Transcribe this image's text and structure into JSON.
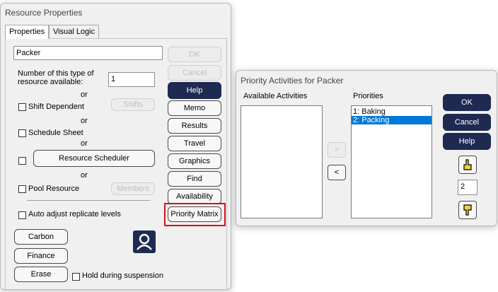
{
  "resource_dialog": {
    "title": "Resource Properties",
    "tabs": [
      "Properties",
      "Visual Logic"
    ],
    "name_value": "Packer",
    "count_label_line1": "Number of this type of",
    "count_label_line2": "resource available:",
    "count_value": "1",
    "or_text": "or",
    "shift_dependent_label": "Shift Dependent",
    "shifts_button": "Shifts",
    "schedule_sheet_label": "Schedule Sheet",
    "resource_scheduler_button": "Resource Scheduler",
    "pool_resource_label": "Pool Resource",
    "members_button": "Members",
    "auto_adjust_label": "Auto adjust replicate levels",
    "carbon_button": "Carbon",
    "finance_button": "Finance",
    "erase_button": "Erase",
    "hold_label": "Hold during suspension",
    "buttons": {
      "ok": "OK",
      "cancel": "Cancel",
      "help": "Help",
      "memo": "Memo",
      "results": "Results",
      "travel": "Travel",
      "graphics": "Graphics",
      "find": "Find",
      "availability": "Availability",
      "priority_matrix": "Priority Matrix"
    }
  },
  "priority_dialog": {
    "title": "Priority Activities for Packer",
    "available_label": "Available Activities",
    "priorities_label": "Priorities",
    "priorities": [
      "1: Baking",
      "2: Packing"
    ],
    "selected_index": 1,
    "add_button": ">",
    "remove_button": "<",
    "ok": "OK",
    "cancel": "Cancel",
    "help": "Help",
    "position_value": "2"
  },
  "colors": {
    "dark_button": "#1e2a52",
    "highlight": "#d3131a",
    "selection": "#0078d7"
  }
}
